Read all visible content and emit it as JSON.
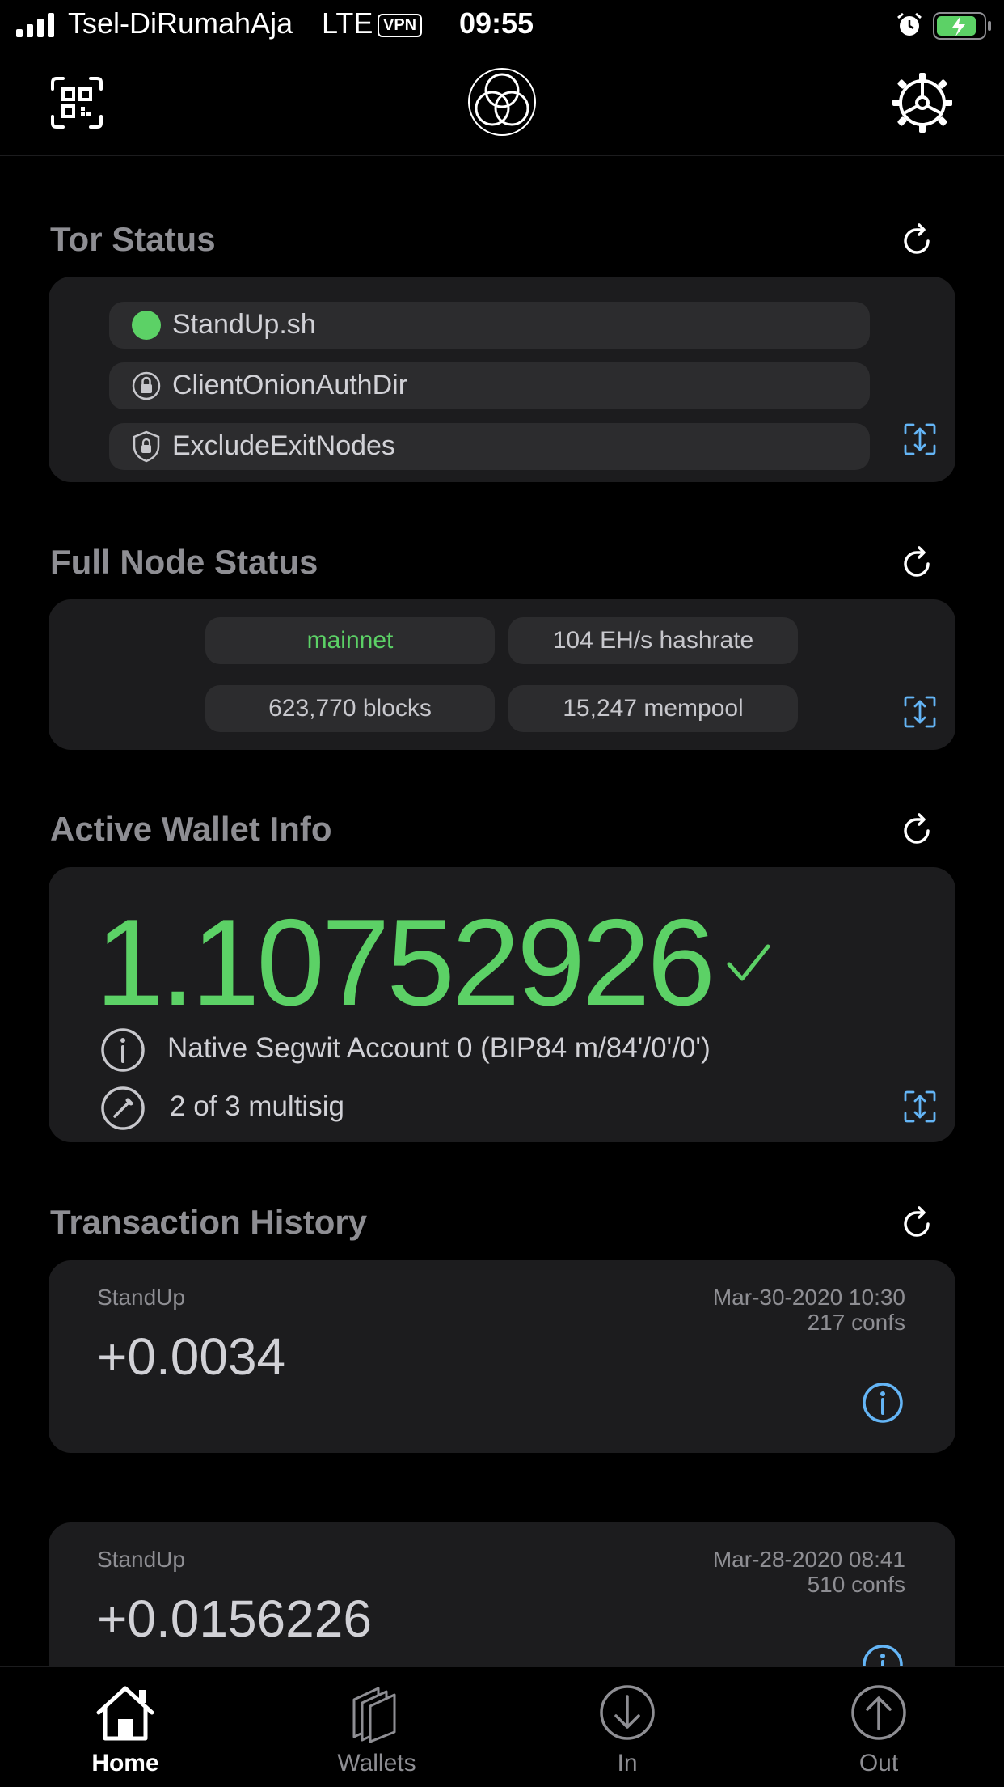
{
  "status_bar": {
    "carrier": "Tsel-DiRumahAja",
    "network": "LTE",
    "vpn": "VPN",
    "time": "09:55"
  },
  "nav": {
    "left_icon": "qr-code-icon",
    "center_icon": "app-logo-icon",
    "right_icon": "gear-icon"
  },
  "tor": {
    "title": "Tor Status",
    "items": [
      {
        "label": "StandUp.sh",
        "icon": "status-dot-icon",
        "color": "#5cd166"
      },
      {
        "label": "ClientOnionAuthDir",
        "icon": "lock-icon"
      },
      {
        "label": "ExcludeExitNodes",
        "icon": "shield-lock-icon"
      }
    ]
  },
  "node": {
    "title": "Full Node Status",
    "network": "mainnet",
    "hashrate": "104 EH/s hashrate",
    "blocks": "623,770 blocks",
    "mempool": "15,247 mempool"
  },
  "wallet": {
    "title": "Active Wallet Info",
    "balance": "1.10752926",
    "account": "Native Segwit Account 0 (BIP84 m/84'/0'/0')",
    "type": "2 of 3 multisig"
  },
  "transactions": {
    "title": "Transaction History",
    "items": [
      {
        "label": "StandUp",
        "amount": "+0.0034",
        "date": "Mar-30-2020 10:30",
        "confs": "217 confs"
      },
      {
        "label": "StandUp",
        "amount": "+0.0156226",
        "date": "Mar-28-2020 08:41",
        "confs": "510 confs"
      }
    ]
  },
  "tabs": [
    {
      "label": "Home",
      "icon": "home-icon",
      "active": true
    },
    {
      "label": "Wallets",
      "icon": "wallets-icon",
      "active": false
    },
    {
      "label": "In",
      "icon": "arrow-down-circle-icon",
      "active": false
    },
    {
      "label": "Out",
      "icon": "arrow-up-circle-icon",
      "active": false
    }
  ],
  "colors": {
    "accent_green": "#5cd166",
    "accent_blue": "#64b5f6",
    "card_bg": "#1c1c1e"
  }
}
